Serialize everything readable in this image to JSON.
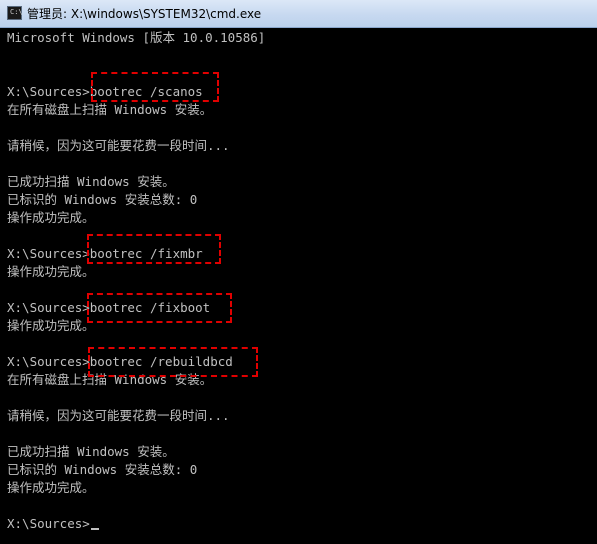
{
  "window": {
    "title": "管理员: X:\\windows\\SYSTEM32\\cmd.exe",
    "icon": "cmd-icon"
  },
  "console": {
    "lines": [
      "Microsoft Windows [版本 10.0.10586]",
      "",
      "",
      "X:\\Sources>bootrec /scanos",
      "在所有磁盘上扫描 Windows 安装。",
      "",
      "请稍候，因为这可能要花费一段时间...",
      "",
      "已成功扫描 Windows 安装。",
      "已标识的 Windows 安装总数: 0",
      "操作成功完成。",
      "",
      "X:\\Sources>bootrec /fixmbr",
      "操作成功完成。",
      "",
      "X:\\Sources>bootrec /fixboot",
      "操作成功完成。",
      "",
      "X:\\Sources>bootrec /rebuildbcd",
      "在所有磁盘上扫描 Windows 安装。",
      "",
      "请稍候，因为这可能要花费一段时间...",
      "",
      "已成功扫描 Windows 安装。",
      "已标识的 Windows 安装总数: 0",
      "操作成功完成。",
      "",
      "X:\\Sources>"
    ]
  },
  "colors": {
    "console_bg": "#000000",
    "console_fg": "#c0c0c0",
    "highlight": "#e00000"
  }
}
